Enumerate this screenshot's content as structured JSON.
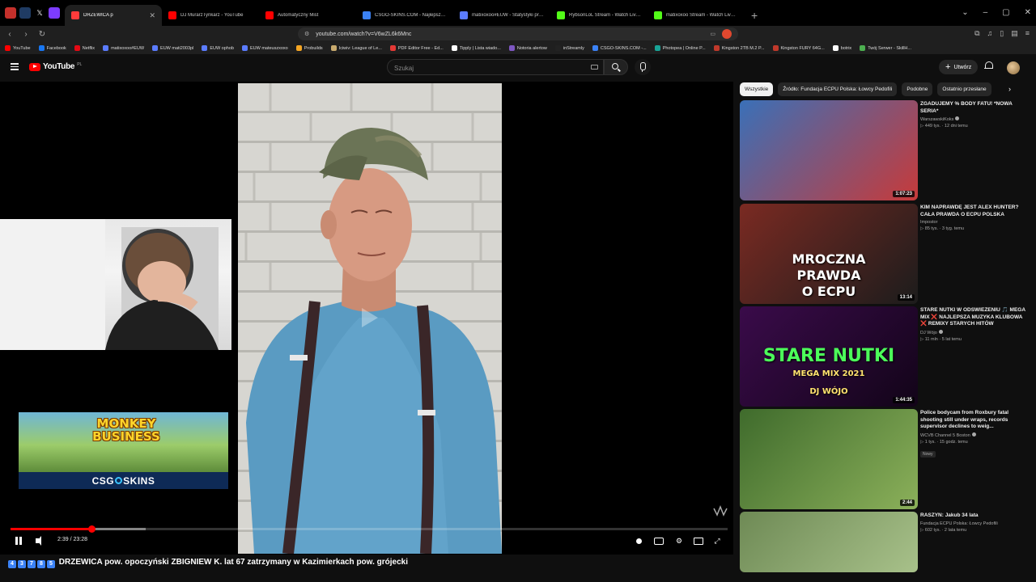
{
  "browser": {
    "tabs": [
      {
        "title": "DRZEWICA p",
        "active": true,
        "color": "#ff3b3b"
      },
      {
        "title": "DJ MurarzTynkarz - YouTube",
        "color": "#ff0000"
      },
      {
        "title": "Automatyczny Mist",
        "color": "#ff0000"
      },
      {
        "title": "CSGO-SKINS.COM - Najlepsze Skrzy",
        "color": "#3b82f6"
      },
      {
        "title": "matixoxoo#EUW - Statystyki przywo",
        "color": "#5b7cff"
      },
      {
        "title": "RybsonLoL Stream - Watch Live on K",
        "color": "#53fc18"
      },
      {
        "title": "matixoxoo Stream - Watch Live on K",
        "color": "#53fc18"
      }
    ],
    "new_tab": "+",
    "url": "youtube.com/watch?v=V6wZL6k6Mnc",
    "bookmarks": [
      {
        "label": "YouTube",
        "color": "#ff0000"
      },
      {
        "label": "Facebook",
        "color": "#1877f2"
      },
      {
        "label": "Netflix",
        "color": "#e50914"
      },
      {
        "label": "matixoxoo#EUW",
        "color": "#5b7cff"
      },
      {
        "label": "EUW mati2003pl",
        "color": "#5b7cff"
      },
      {
        "label": "EUW ophob",
        "color": "#5b7cff"
      },
      {
        "label": "EUW mateuszxoxo",
        "color": "#5b7cff"
      },
      {
        "label": "Probuilds",
        "color": "#f5a623"
      },
      {
        "label": "Iciwiv: League of Le...",
        "color": "#c8aa6e"
      },
      {
        "label": "PDF Editor Free - Ed...",
        "color": "#e53935"
      },
      {
        "label": "Tipply | Lista wiado...",
        "color": "#ffffff"
      },
      {
        "label": "Notoria alertow",
        "color": "#7e57c2"
      },
      {
        "label": "inStreamly",
        "color": "#222222"
      },
      {
        "label": "CSGO-SKINS.COM -...",
        "color": "#3b82f6"
      },
      {
        "label": "Photopea | Online P...",
        "color": "#18a497"
      },
      {
        "label": "Kingston 2TB M.2 P...",
        "color": "#c0392b"
      },
      {
        "label": "Kingston FURY 64G...",
        "color": "#c0392b"
      },
      {
        "label": "botrix",
        "color": "#ffffff"
      },
      {
        "label": "Twój Serwer - SkillH...",
        "color": "#4caf50"
      }
    ]
  },
  "youtube": {
    "logo_text": "YouTube",
    "country": "PL",
    "search_placeholder": "Szukaj",
    "create_label": "Utwórz"
  },
  "player": {
    "current_time": "2:39",
    "duration": "23:28",
    "time_display": "2:39 / 23:28",
    "played_fraction": 0.113,
    "buffered_fraction": 0.188,
    "ad": {
      "title": "MONKEY BUSINESS",
      "brand_left": "CSG",
      "brand_right": "SKINS"
    }
  },
  "video_title": "DRZEWICA pow. opoczyński ZBIGNIEW K. lat 67 zatrzymany w Kazimierkach pow. grójecki",
  "video_title_prefix": [
    "4",
    "3",
    "7",
    "8",
    "5"
  ],
  "sidebar": {
    "chips": [
      {
        "label": "Wszystkie",
        "selected": true
      },
      {
        "label": "Źródło: Fundacja ECPU Polska: Łowcy Pedofili"
      },
      {
        "label": "Podobne"
      },
      {
        "label": "Ostatnio przesłane"
      }
    ],
    "recommendations": [
      {
        "title": "ZGADUJEMY % BODY FATU! *NOWA SERIA*",
        "channel": "WarszawskiKoks",
        "verified": true,
        "views": "449 tys.",
        "age": "12 dni temu",
        "duration": "1:07:23",
        "thumb_colors": [
          "#3a70b8",
          "#c73a3a"
        ]
      },
      {
        "title": "KIM NAPRAWDĘ JEST ALEX HUNTER? CAŁA PRAWDA O ECPU POLSKA",
        "channel": "Impostor",
        "verified": false,
        "views": "85 tys.",
        "age": "3 tyg. temu",
        "duration": "13:14",
        "thumb_colors": [
          "#7a2a22",
          "#1c1c1c"
        ],
        "thumb_text": [
          "MROCZNA",
          "PRAWDA",
          "O ECPU"
        ]
      },
      {
        "title": "STARE NUTKI W ODŚWIEŻENIU 🎵 MEGA MIX ❌ NAJLEPSZA MUZYKA KLUBOWA ❌ REMIXY STARYCH HITÓW",
        "channel": "DJ Wójo",
        "verified": true,
        "views": "11 mln",
        "age": "5 lat temu",
        "duration": "1:44:35",
        "thumb_colors": [
          "#3a0b4a",
          "#120418"
        ],
        "thumb_text": [
          "STARE NUTKI",
          "MEGA MIX 2021",
          "DJ WÓJO"
        ]
      },
      {
        "title": "Police bodycam from Roxbury fatal shooting still under wraps, records supervisor declines to weig...",
        "channel": "WCVB Channel 5 Boston",
        "verified": true,
        "views": "1 tys.",
        "age": "15 godz. temu",
        "duration": "2:44",
        "badge": "Nowy",
        "thumb_colors": [
          "#3f6b2c",
          "#8bb05a"
        ]
      },
      {
        "title": "RASZYN: Jakub 34 lata",
        "channel": "Fundacja ECPU Polska: Łowcy Pedofili",
        "verified": false,
        "views": "602 tys.",
        "age": "2 lata temu",
        "duration": "",
        "thumb_colors": [
          "#6e8a55",
          "#a8c18a"
        ]
      }
    ]
  }
}
